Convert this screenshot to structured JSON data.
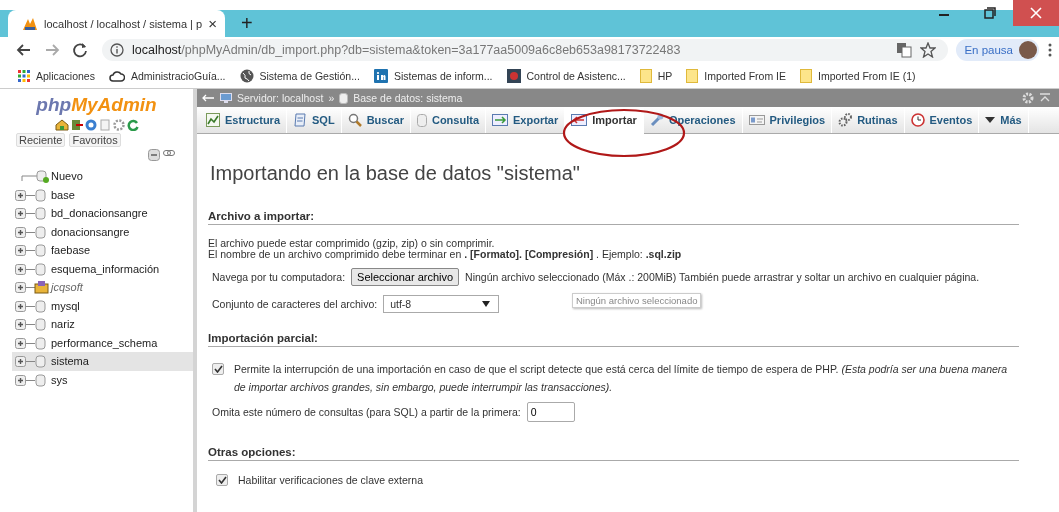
{
  "browser": {
    "tab": {
      "title": "localhost / localhost / sistema | p",
      "close": "×"
    },
    "new_tab": "+",
    "address": {
      "host": "localhost",
      "path": "/phpMyAdmin/db_import.php?db=sistema&token=3a177aa5009a6c8eb653a98173722483"
    },
    "profile": "En pausa",
    "bookmarks": [
      {
        "label": "Aplicaciones",
        "kind": "apps"
      },
      {
        "label": "AdministracioGuía...",
        "kind": "cloud"
      },
      {
        "label": "Sistema de Gestión...",
        "kind": "globe"
      },
      {
        "label": "Sistemas de inform...",
        "kind": "linkedin"
      },
      {
        "label": "Control de Asistenc...",
        "kind": "app"
      },
      {
        "label": "HP",
        "kind": "folder"
      },
      {
        "label": "Imported From IE",
        "kind": "folder"
      },
      {
        "label": "Imported From IE (1)",
        "kind": "folder"
      }
    ]
  },
  "sidebar": {
    "logo": {
      "php": "php",
      "myadmin": "MyAdmin"
    },
    "buttons": [
      "Reciente",
      "Favoritos"
    ],
    "tree": [
      {
        "label": "Nuevo",
        "kind": "new",
        "selected": false
      },
      {
        "label": "base",
        "kind": "database",
        "selected": false
      },
      {
        "label": "bd_donacionsangre",
        "kind": "database",
        "selected": false
      },
      {
        "label": "donacionsangre",
        "kind": "database",
        "selected": false
      },
      {
        "label": "faebase",
        "kind": "database",
        "selected": false
      },
      {
        "label": "esquema_información",
        "kind": "database",
        "selected": false
      },
      {
        "label": "jcqsoft",
        "kind": "special",
        "selected": false
      },
      {
        "label": "mysql",
        "kind": "database",
        "selected": false
      },
      {
        "label": "nariz",
        "kind": "database",
        "selected": false
      },
      {
        "label": "performance_schema",
        "kind": "database",
        "selected": false
      },
      {
        "label": "sistema",
        "kind": "database",
        "selected": true
      },
      {
        "label": "sys",
        "kind": "database",
        "selected": false
      }
    ]
  },
  "breadcrumb": [
    "Servidor: localhost",
    "Base de datos: sistema"
  ],
  "breadcrumb_separator": "»",
  "tabs": [
    {
      "label": "Estructura",
      "selected": false
    },
    {
      "label": "SQL",
      "selected": false
    },
    {
      "label": "Buscar",
      "selected": false
    },
    {
      "label": "Consulta",
      "selected": false
    },
    {
      "label": "Exportar",
      "selected": false
    },
    {
      "label": "Importar",
      "selected": true
    },
    {
      "label": "Operaciones",
      "selected": false
    },
    {
      "label": "Privilegios",
      "selected": false
    },
    {
      "label": "Rutinas",
      "selected": false
    },
    {
      "label": "Eventos",
      "selected": false
    },
    {
      "label": "Más",
      "selected": false
    }
  ],
  "heading": "Importando en la base de datos \"sistema\"",
  "file_section": {
    "title": "Archivo a importar:",
    "lines": [
      "El archivo puede estar comprimido (gzip, zip) o sin comprimir.",
      "El nombre de un archivo comprimido debe terminar en **. [Formato]. [Compresión]** . Ejemplo: **.sql.zip**"
    ],
    "browse_label": "Navega por tu computadora:",
    "browse_button": "Seleccionar archivo",
    "browse_note": "Ningún archivo seleccionado (Máx .: 200MiB) También puede arrastrar y soltar un archivo en cualquier página.",
    "tooltip": "Ningún archivo seleccionado",
    "charset_label": "Conjunto de caracteres del archivo:",
    "charset_value": "utf-8"
  },
  "partial_section": {
    "title": "Importación parcial:",
    "allow_interrupt": {
      "checked": true,
      "text": "Permite la interrupción de una importación en caso de que el script detecte que está cerca del límite de tiempo de espera de PHP. *(Esta podría ser una buena manera de importar archivos grandes, sin embargo, puede interrumpir las transacciones).*"
    },
    "skip_label": "Omita este número de consultas (para SQL) a partir de la primera:",
    "skip_value": "0"
  },
  "other_section": {
    "title": "Otras opciones:",
    "foreign_keys": {
      "checked": true,
      "text": "Habilitar verificaciones de clave externa"
    }
  }
}
